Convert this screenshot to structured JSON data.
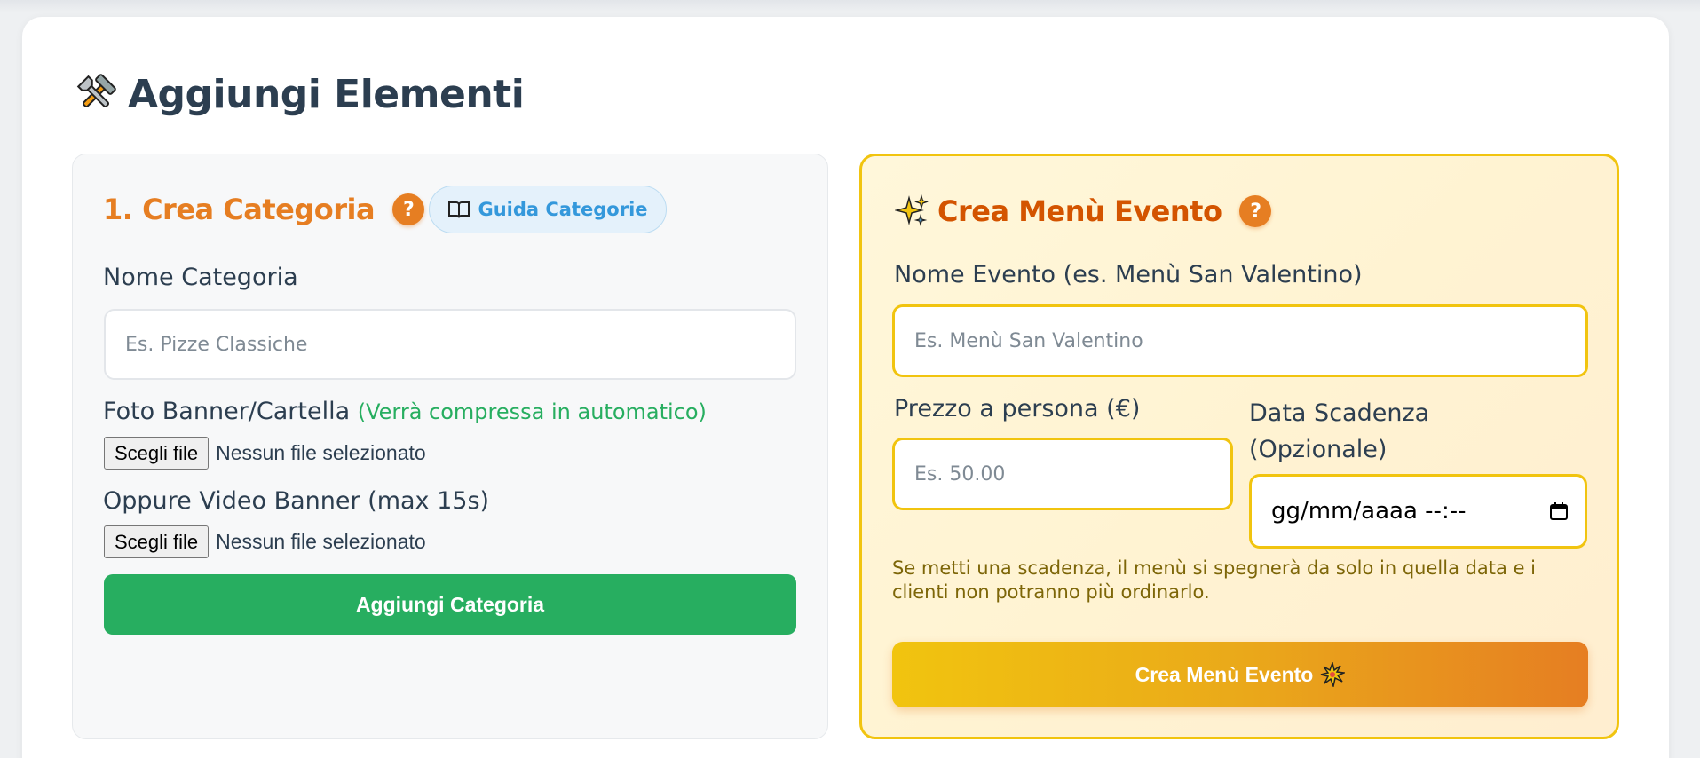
{
  "page": {
    "title": "Aggiungi Elementi",
    "title_icon": "hammer-wrench-icon"
  },
  "category": {
    "title": "1. Crea Categoria",
    "help_label": "?",
    "guide_label": "Guida Categorie",
    "guide_icon": "book-icon",
    "name_label": "Nome Categoria",
    "name_placeholder": "Es. Pizze Classiche",
    "name_value": "",
    "photo_label": "Foto Banner/Cartella",
    "photo_note": "(Verrà compressa in automatico)",
    "photo_button": "Scegli file",
    "photo_status": "Nessun file selezionato",
    "video_label": "Oppure Video Banner (max 15s)",
    "video_button": "Scegli file",
    "video_status": "Nessun file selezionato",
    "submit_label": "Aggiungi Categoria"
  },
  "event": {
    "title": "Crea Menù Evento",
    "title_icon": "sparkles-icon",
    "help_label": "?",
    "name_label": "Nome Evento (es. Menù San Valentino)",
    "name_placeholder": "Es. Menù San Valentino",
    "name_value": "",
    "price_label": "Prezzo a persona (€)",
    "price_placeholder": "Es. 50.00",
    "price_value": "",
    "date_label_line1": "Data Scadenza",
    "date_label_line2": "(Opzionale)",
    "date_placeholder": "gg/mm/aaaa --:--",
    "hint": "Se metti una scadenza, il menù si spegnerà da solo in quella data e i clienti non potranno più ordinarlo.",
    "submit_label": "Crea Menù Evento",
    "submit_icon": "collision-spark-icon"
  },
  "colors": {
    "primary_text": "#2c3e50",
    "orange": "#e67e22",
    "dark_orange": "#d35400",
    "green": "#27ae60",
    "yellow": "#f1c40f",
    "blue": "#3498db"
  }
}
